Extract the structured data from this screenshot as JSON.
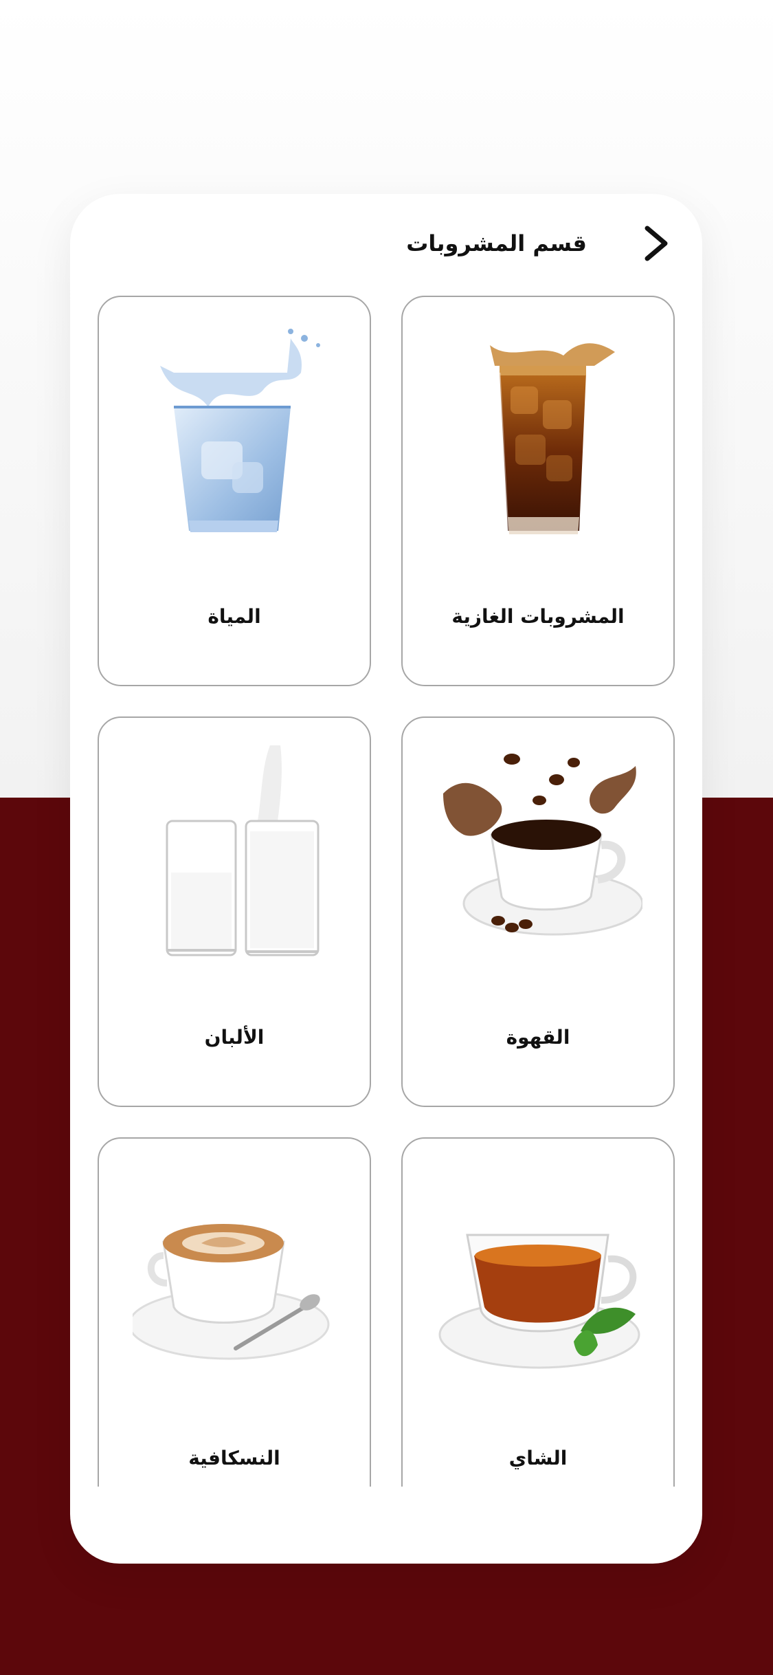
{
  "header": {
    "title": "قسم المشروبات",
    "back_icon": "chevron-right-icon"
  },
  "categories": [
    {
      "label": "المشروبات الغازية",
      "icon": "soda-glass-icon"
    },
    {
      "label": "المياة",
      "icon": "water-glass-icon"
    },
    {
      "label": "القهوة",
      "icon": "coffee-cup-icon"
    },
    {
      "label": "الألبان",
      "icon": "milk-glasses-icon"
    },
    {
      "label": "الشاي",
      "icon": "tea-cup-icon"
    },
    {
      "label": "النسكافية",
      "icon": "latte-cup-icon"
    }
  ],
  "colors": {
    "background_top": "#f2f2f2",
    "background_bottom": "#5c070b",
    "card": "#ffffff",
    "tile_border": "#a6a6a6",
    "text": "#111111"
  }
}
